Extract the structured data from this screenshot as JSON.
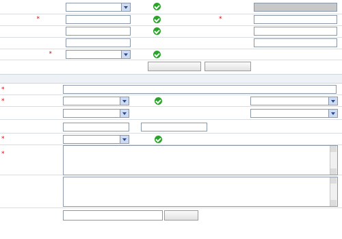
{
  "rows": {
    "r1": {
      "label": "",
      "select": "",
      "status": "",
      "label2": "",
      "field2": ""
    },
    "r2": {
      "label": "",
      "input": "",
      "status": "",
      "label2": "",
      "field2": ""
    },
    "r3": {
      "label": "",
      "input": "",
      "status": "",
      "label2": ""
    },
    "r4": {
      "label": "",
      "input": "",
      "label2": "",
      "field2": ""
    },
    "r5": {
      "label": "",
      "select": "",
      "status": ""
    }
  },
  "actions": {
    "btn1": "",
    "btn2": ""
  },
  "section": {
    "title": ""
  },
  "form2": {
    "f1": {
      "label": "",
      "input": ""
    },
    "f2": {
      "label": "",
      "select1": "",
      "status": "",
      "label2": "",
      "select2": ""
    },
    "f3": {
      "label": "",
      "select1": "",
      "label2": "",
      "select2": ""
    },
    "f4": {
      "label": "",
      "from": "",
      "to_label": "",
      "to": ""
    },
    "f5": {
      "label": "",
      "select": "",
      "status": ""
    },
    "f6": {
      "label_line1": "",
      "label_line2": "",
      "text": ""
    },
    "f7": {
      "label_line1": "",
      "label_line2": ""
    },
    "f8": {
      "browse": ""
    },
    "f9": {
      "label": "",
      "hint_prefix": "",
      "hint_link1": "",
      "hint_mid": "",
      "hint_red": "",
      "hint_link2": ""
    },
    "f10": {
      "formats": ""
    }
  }
}
